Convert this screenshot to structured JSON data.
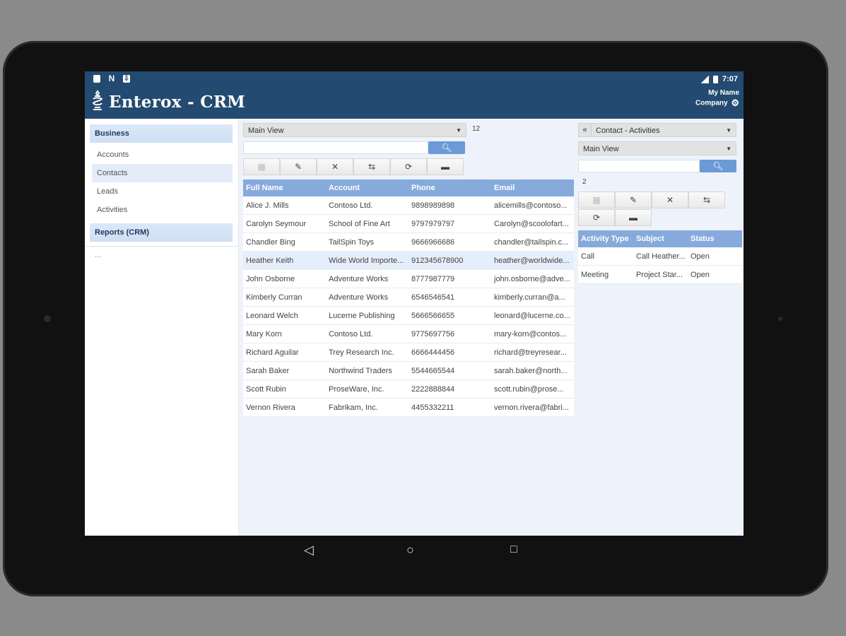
{
  "status_bar": {
    "left_icons": [
      "sd-card-icon",
      "n-notification-icon",
      "download-icon"
    ],
    "time": "7:07"
  },
  "header": {
    "app_title": "Enterox - CRM",
    "user_name": "My Name",
    "company": "Company"
  },
  "sidebar": {
    "business_label": "Business",
    "items": [
      {
        "label": "Accounts"
      },
      {
        "label": "Contacts"
      },
      {
        "label": "Leads"
      },
      {
        "label": "Activities"
      }
    ],
    "reports_label": "Reports (CRM)",
    "more_label": "..."
  },
  "main": {
    "view_select": "Main View",
    "record_count": "12",
    "columns": [
      "Full Name",
      "Account",
      "Phone",
      "Email"
    ],
    "rows": [
      [
        "Alice J. Mills",
        "Contoso Ltd.",
        "9898989898",
        "alicemills@contoso..."
      ],
      [
        "Carolyn Seymour",
        "School of Fine Art",
        "9797979797",
        "Carolyn@scoolofart..."
      ],
      [
        "Chandler Bing",
        "TailSpin Toys",
        "9666966686",
        "chandler@tailspin.c..."
      ],
      [
        "Heather Keith",
        "Wide World Importe...",
        "912345678900",
        "heather@worldwide..."
      ],
      [
        "John Osborne",
        "Adventure Works",
        "8777987779",
        "john.osborne@adve..."
      ],
      [
        "Kimberly Curran",
        "Adventure Works",
        "6546546541",
        "kimberly.curran@a..."
      ],
      [
        "Leonard Welch",
        "Lucerne Publishing",
        "5666566655",
        "leonard@lucerne.co..."
      ],
      [
        "Mary Korn",
        "Contoso Ltd.",
        "9775697756",
        "mary-korn@contos..."
      ],
      [
        "Richard Aguilar",
        "Trey Research Inc.",
        "6666444456",
        "richard@treyresear..."
      ],
      [
        "Sarah Baker",
        "Northwind Traders",
        "5544665544",
        "sarah.baker@north..."
      ],
      [
        "Scott Rubin",
        "ProseWare, Inc.",
        "2222888844",
        "scott.rubin@prose..."
      ],
      [
        "Vernon Rivera",
        "Fabrikam, Inc.",
        "4455332211",
        "vernon.rivera@fabri..."
      ]
    ],
    "highlighted_row": 3
  },
  "right_panel": {
    "entity_select": "Contact - Activities",
    "view_select": "Main View",
    "record_count": "2",
    "columns": [
      "Activity Type",
      "Subject",
      "Status"
    ],
    "rows": [
      [
        "Call",
        "Call Heather...",
        "Open"
      ],
      [
        "Meeting",
        "Project Star...",
        "Open"
      ]
    ]
  },
  "toolbar_icons": [
    "new-icon",
    "edit-icon",
    "delete-icon",
    "export-icon",
    "refresh-icon",
    "more-icon"
  ],
  "colors": {
    "header_bg": "#234a70",
    "table_header": "#86aadb",
    "search_button": "#6b9ad6",
    "page_bg": "#eef3fb"
  }
}
